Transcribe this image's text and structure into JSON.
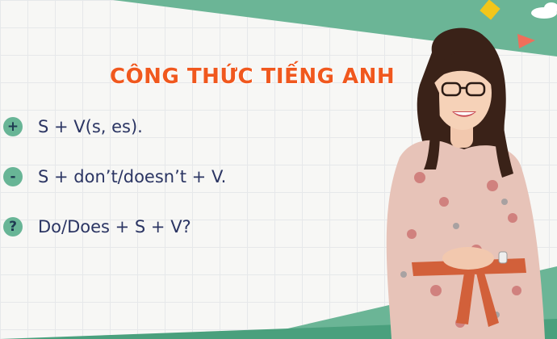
{
  "title": "CÔNG THỨC TIẾNG ANH",
  "formulas": [
    {
      "symbol": "+",
      "text": "S + V(s, es)."
    },
    {
      "symbol": "-",
      "text": "S + don’t/doesn’t + V."
    },
    {
      "symbol": "?",
      "text": "Do/Does + S + V?"
    }
  ],
  "colors": {
    "accent_green": "#68b596",
    "title_orange": "#f0581e",
    "text_navy": "#2b3563"
  }
}
